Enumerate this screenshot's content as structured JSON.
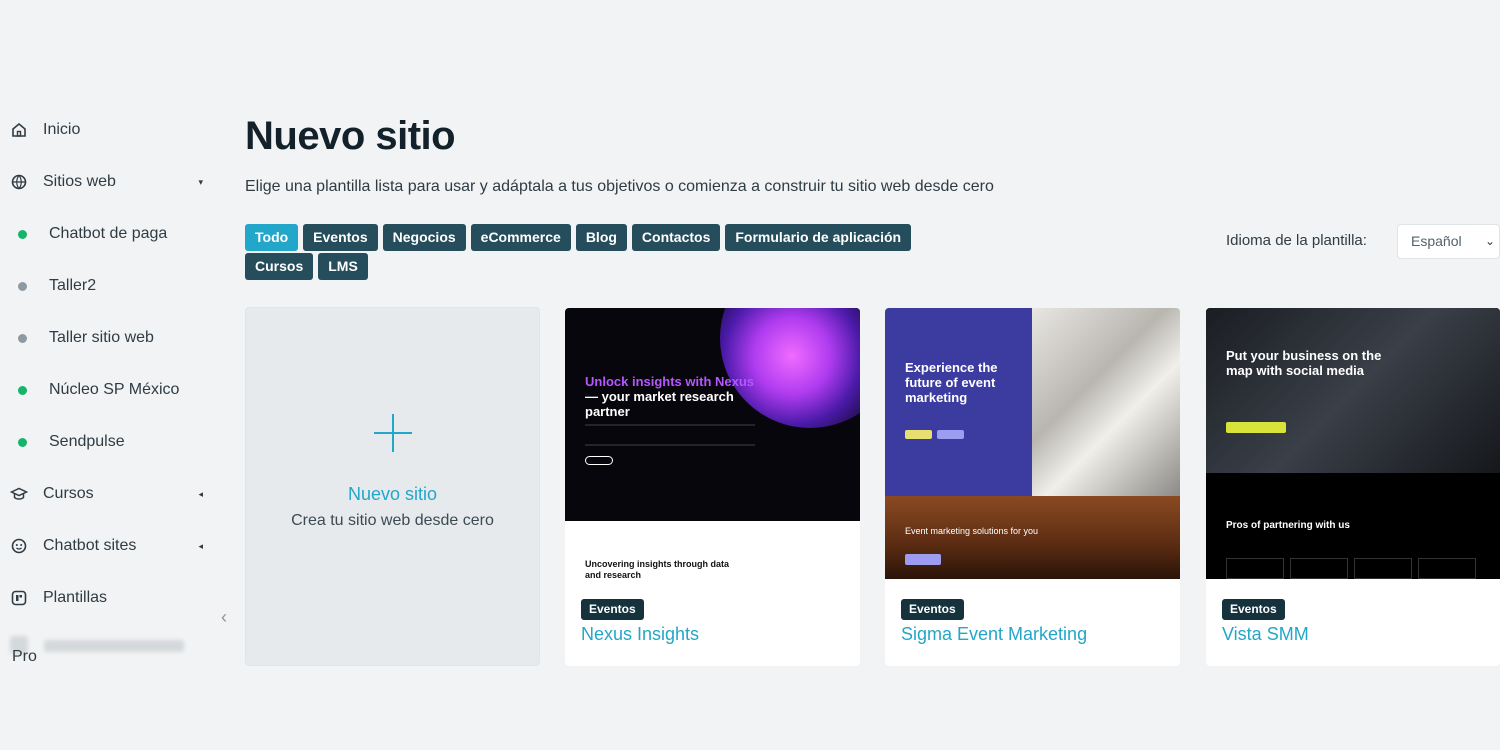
{
  "sidebar": {
    "items": [
      {
        "label": "Inicio",
        "icon": "home-icon"
      },
      {
        "label": "Sitios web",
        "icon": "globe-icon",
        "caret": "▾"
      },
      {
        "label": "Chatbot de paga",
        "dot_color": "#15b569"
      },
      {
        "label": "Taller2",
        "dot_color": "#8e9aa1"
      },
      {
        "label": "Taller sitio web",
        "dot_color": "#8e9aa1"
      },
      {
        "label": "Núcleo SP México",
        "dot_color": "#15b569"
      },
      {
        "label": "Sendpulse",
        "dot_color": "#15b569"
      },
      {
        "label": "Cursos",
        "icon": "graduation-cap-icon",
        "caret": "◂"
      },
      {
        "label": "Chatbot sites",
        "icon": "chat-bot-icon",
        "caret": "◂"
      },
      {
        "label": "Plantillas",
        "icon": "template-icon"
      }
    ],
    "pro_label": "Pro",
    "collapse_glyph": "‹"
  },
  "main": {
    "title": "Nuevo sitio",
    "subtitle": "Elige una plantilla lista para usar y adáptala a tus objetivos o comienza a construir tu sitio web desde cero",
    "filters_row1": [
      "Todo",
      "Eventos",
      "Negocios",
      "eCommerce",
      "Blog",
      "Contactos",
      "Formulario de aplicación"
    ],
    "filters_row2": [
      "Cursos",
      "LMS"
    ],
    "active_filter": "Todo",
    "language_label": "Idioma de la plantilla:",
    "language_value": "Español"
  },
  "new_site_card": {
    "title": "Nuevo sitio",
    "description": "Crea tu sitio web desde cero"
  },
  "templates": [
    {
      "tag": "Eventos",
      "name": "Nexus Insights",
      "preview": {
        "headline_accent": "Unlock insights with Nexus",
        "headline_rest": " — your market research partner",
        "lower_text": "Uncovering insights through data and research"
      }
    },
    {
      "tag": "Eventos",
      "name": "Sigma Event Marketing",
      "preview": {
        "headline": "Experience the future of event marketing",
        "lower_text": "Event marketing solutions for you"
      }
    },
    {
      "tag": "Eventos",
      "name": "Vista SMM",
      "preview": {
        "headline": "Put your business on the map with social media",
        "lower_text": "Pros of partnering with us"
      }
    }
  ],
  "colors": {
    "accent": "#22a6c9",
    "chip": "#264d5c",
    "tag": "#16323d",
    "background": "#f1f3f4"
  }
}
